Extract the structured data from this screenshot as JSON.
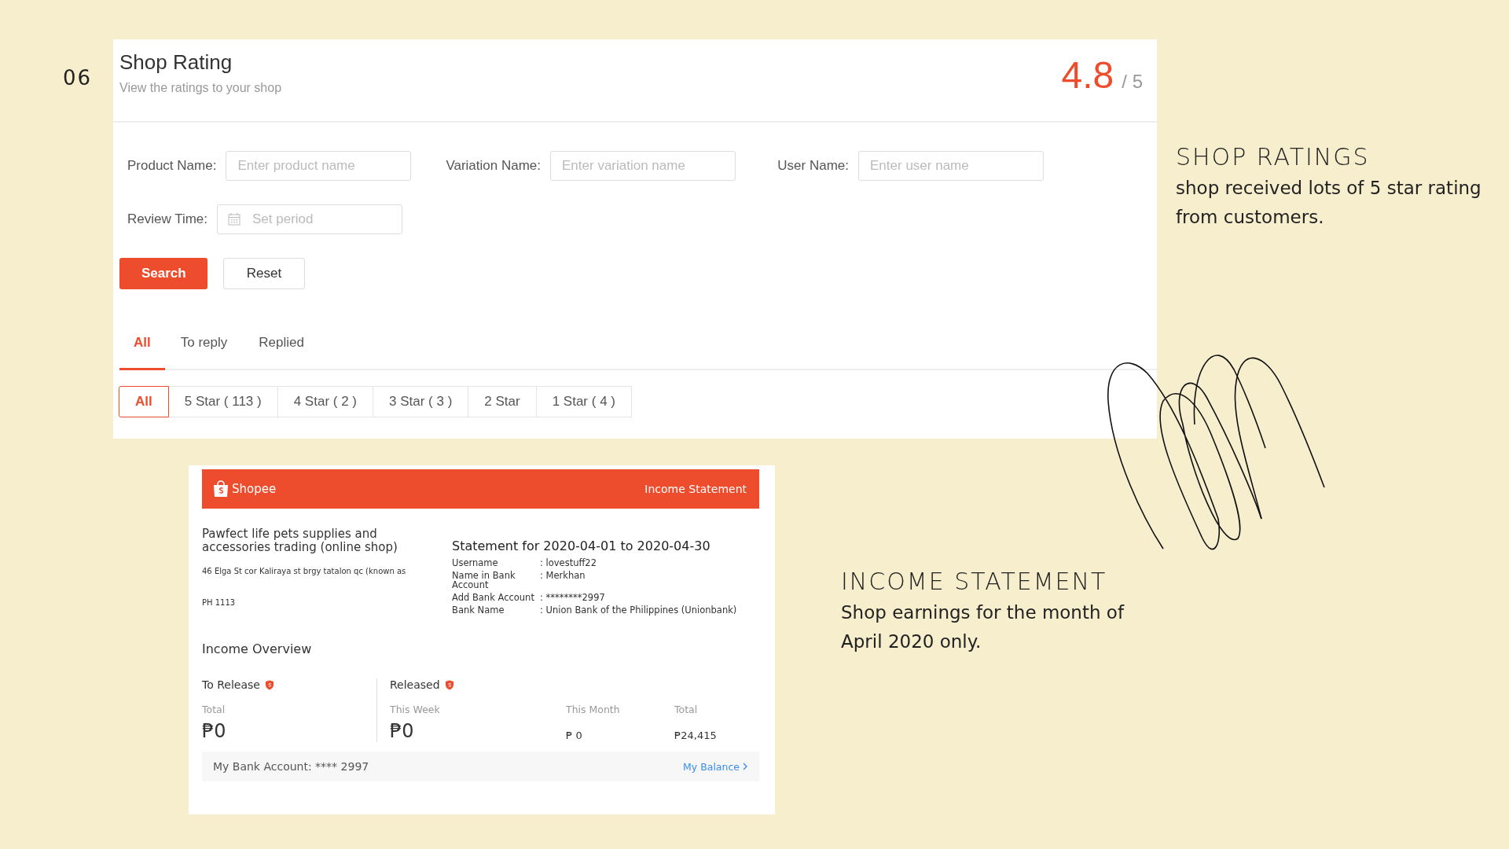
{
  "slide_number": "06",
  "rating_panel": {
    "title": "Shop Rating",
    "subtitle": "View the ratings to your shop",
    "score": "4.8",
    "out_of": "/ 5",
    "filters": [
      {
        "label": "Product Name:",
        "placeholder": "Enter product name",
        "kind": "text"
      },
      {
        "label": "Variation Name:",
        "placeholder": "Enter variation name",
        "kind": "text"
      },
      {
        "label": "User Name:",
        "placeholder": "Enter user name",
        "kind": "text"
      },
      {
        "label": "Review Time:",
        "placeholder": "Set period",
        "kind": "date"
      }
    ],
    "buttons": [
      {
        "label": "Search",
        "kind": "primary"
      },
      {
        "label": "Reset",
        "kind": "secondary"
      }
    ],
    "tabs": [
      {
        "label": "All",
        "selected": true
      },
      {
        "label": "To reply",
        "selected": false
      },
      {
        "label": "Replied",
        "selected": false
      }
    ],
    "star_filters": [
      {
        "label": "All",
        "selected": true
      },
      {
        "label": "5 Star ( 113 )",
        "selected": false
      },
      {
        "label": "4 Star ( 2 )",
        "selected": false
      },
      {
        "label": "3 Star ( 3 )",
        "selected": false
      },
      {
        "label": "2 Star",
        "selected": false
      },
      {
        "label": "1 Star ( 4 )",
        "selected": false
      }
    ]
  },
  "income_statement": {
    "brand": "Shopee",
    "header_title": "Income Statement",
    "shop_name": "Pawfect life pets supplies and accessories trading (online shop)",
    "address_lines": [
      "46 Elga St cor Kaliraya st brgy tatalon qc (known as",
      "PH 1113"
    ],
    "statement_period": "Statement for 2020-04-01 to 2020-04-30",
    "details": [
      {
        "label": "Username",
        "value": ": lovestuff22"
      },
      {
        "label": "Name in Bank Account",
        "value": ": Merkhan"
      },
      {
        "label": "Add Bank Account",
        "value": ": ********2997"
      },
      {
        "label": "Bank Name",
        "value": ": Union Bank of the Philippines (Unionbank)"
      }
    ],
    "overview_title": "Income Overview",
    "to_release": {
      "title": "To Release",
      "items": [
        {
          "label": "Total",
          "value": "₱0",
          "kind": "large"
        }
      ]
    },
    "released": {
      "title": "Released",
      "items": [
        {
          "label": "This Week",
          "value": "₱0",
          "kind": "large"
        },
        {
          "label": "This Month",
          "value": "₱ 0",
          "kind": "small"
        },
        {
          "label": "Total",
          "value": "₱24,415",
          "kind": "small"
        }
      ]
    },
    "bank_account": "My Bank Account: **** 2997",
    "balance_link": "My Balance"
  },
  "notes": [
    {
      "title": "SHOP RATINGS",
      "text": "shop received lots of 5 star rating from customers."
    },
    {
      "title": "INCOME STATEMENT",
      "text": "Shop earnings for the month of April 2020 only."
    }
  ]
}
